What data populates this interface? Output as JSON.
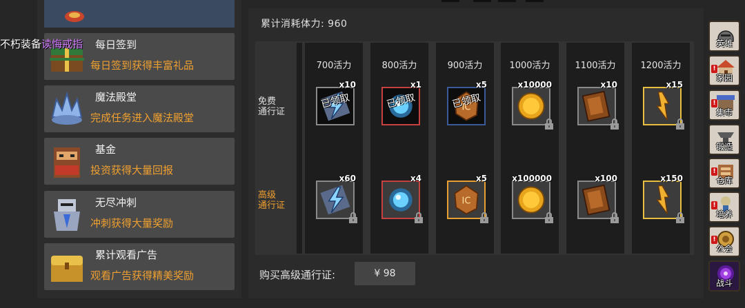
{
  "ticker": {
    "prefix": "不朽装备",
    "highlight": "读悔戒指"
  },
  "events": [
    {
      "title": "每日签到",
      "desc": "每日签到获得丰富礼品"
    },
    {
      "title": "魔法殿堂",
      "desc": "完成任务进入魔法殿堂"
    },
    {
      "title": "基金",
      "desc": "投资获得大量回报"
    },
    {
      "title": "无尽冲刺",
      "desc": "冲刺获得大量奖励"
    },
    {
      "title": "累计观看广告",
      "desc": "观看广告获得精美奖励"
    }
  ],
  "pass": {
    "consumed_label": "累计消耗体力: 960",
    "free_label": "免费\n通行证",
    "premium_label": "高级\n通行证",
    "claimed_text": "已领取",
    "columns": [
      {
        "header": "700活力",
        "free": {
          "item": "lightning-scroll",
          "count": "x10",
          "state": "claimed"
        },
        "premium": {
          "item": "lightning-scroll",
          "count": "x60",
          "state": "locked"
        }
      },
      {
        "header": "800活力",
        "free": {
          "item": "magic-orb",
          "count": "x1",
          "state": "claimed"
        },
        "premium": {
          "item": "magic-orb",
          "count": "x4",
          "state": "locked"
        }
      },
      {
        "header": "900活力",
        "free": {
          "item": "rune-stone",
          "count": "x5",
          "state": "claimed"
        },
        "premium": {
          "item": "rune-stone",
          "count": "x5",
          "state": "locked"
        }
      },
      {
        "header": "1000活力",
        "free": {
          "item": "gold-coin",
          "count": "x10000",
          "state": "locked"
        },
        "premium": {
          "item": "gold-coin",
          "count": "x100000",
          "state": "locked"
        }
      },
      {
        "header": "1100活力",
        "free": {
          "item": "spell-book",
          "count": "x10",
          "state": "locked"
        },
        "premium": {
          "item": "spell-book",
          "count": "x100",
          "state": "locked"
        }
      },
      {
        "header": "1200活力",
        "free": {
          "item": "flame-shard",
          "count": "x15",
          "state": "locked"
        },
        "premium": {
          "item": "flame-shard",
          "count": "x150",
          "state": "locked"
        }
      }
    ],
    "buy_label": "购买高级通行证:",
    "buy_price": "¥ 98"
  },
  "side_menu": [
    {
      "label": "英雄",
      "icon": "helmet-icon",
      "badge": false
    },
    {
      "label": "家园",
      "icon": "house-icon",
      "badge": true
    },
    {
      "label": "集市",
      "icon": "market-icon",
      "badge": true
    },
    {
      "label": "锻造",
      "icon": "anvil-icon",
      "badge": false
    },
    {
      "label": "仓库",
      "icon": "warehouse-icon",
      "badge": true
    },
    {
      "label": "培养",
      "icon": "training-icon",
      "badge": true
    },
    {
      "label": "公会",
      "icon": "guild-icon",
      "badge": true
    },
    {
      "label": "战斗",
      "icon": "portal-icon",
      "badge": false
    }
  ],
  "badge_text": "!",
  "colors": {
    "accent": "#f0a030",
    "highlight": "#d27cff",
    "premium_label": "#f0a030",
    "lock": "#9a9a9a"
  }
}
